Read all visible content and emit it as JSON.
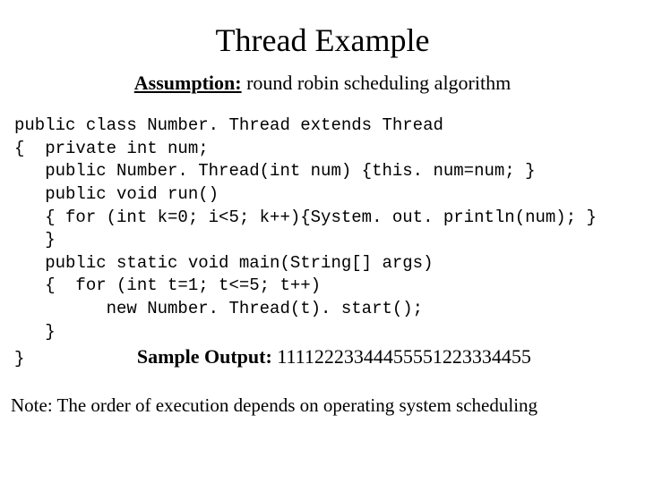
{
  "title": "Thread Example",
  "subtitle_label": "Assumption:",
  "subtitle_rest": " round robin scheduling algorithm",
  "code": {
    "l1": "public class Number. Thread extends Thread",
    "l2": "{  private int num;",
    "l3": "   public Number. Thread(int num) {this. num=num; }",
    "l4": "   public void run()",
    "l5": "   { for (int k=0; i<5; k++){System. out. println(num); }",
    "l6": "   }",
    "l7": "   public static void main(String[] args)",
    "l8": "   {  for (int t=1; t<=5; t++)",
    "l9": "         new Number. Thread(t). start();",
    "l10": "   }",
    "l11": "}           "
  },
  "sample_label": "Sample Output: ",
  "sample_value": "11112223344455551223334455",
  "note": "Note: The order of execution depends on operating system scheduling"
}
